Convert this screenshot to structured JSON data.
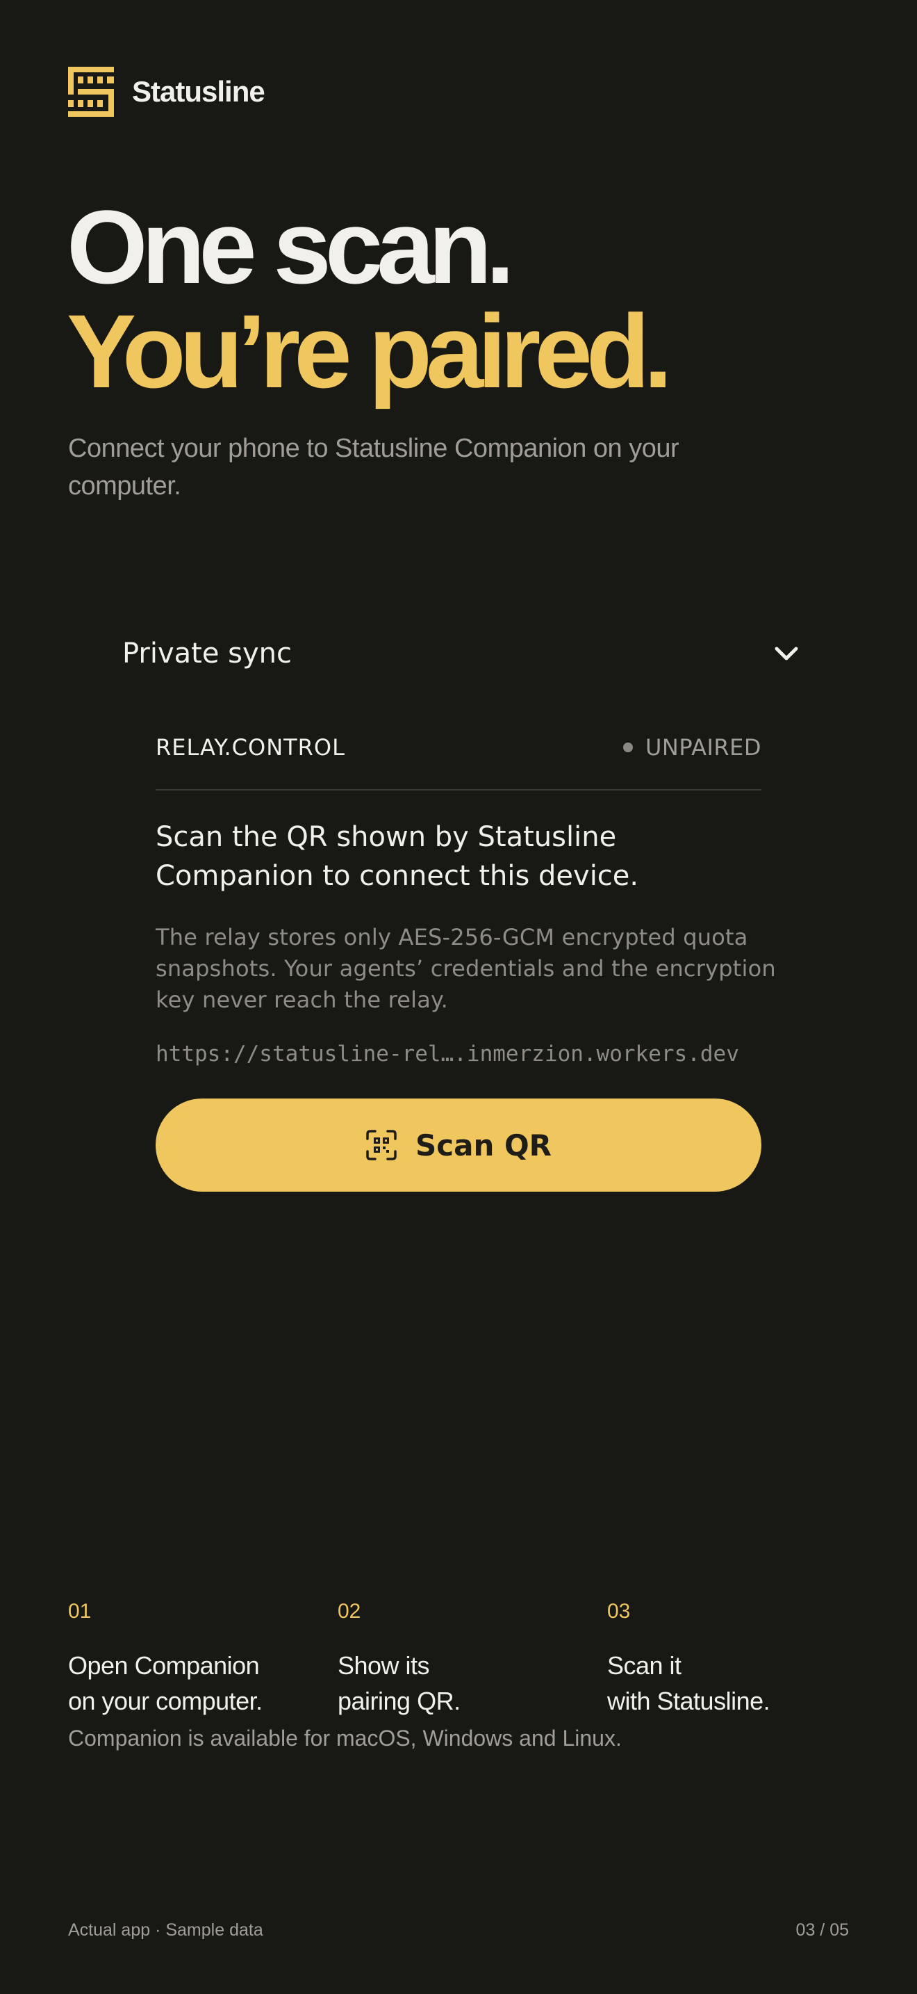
{
  "brand": {
    "name": "Statusline",
    "logo_icon": "statusline-logo-icon",
    "accent": "#efc75e"
  },
  "hero": {
    "line1": "One scan.",
    "line2": "You’re paired.",
    "subtitle": "Connect your phone to Statusline Companion on your computer."
  },
  "sync": {
    "title": "Private sync",
    "chevron_icon": "chevron-down-icon",
    "relay_label": "RELAY.CONTROL",
    "status": "UNPAIRED",
    "instruction": "Scan the QR shown by Statusline Companion to connect this device.",
    "description": "The relay stores only AES-256-GCM encrypted quota snapshots. Your agents’ credentials and the encryption key never reach the relay.",
    "relay_url": "https://statusline-rel….inmerzion.workers.dev",
    "scan_button": {
      "label": "Scan QR",
      "icon": "qr-scan-icon"
    }
  },
  "steps": [
    {
      "num": "01",
      "text": "Open Companion\non your computer."
    },
    {
      "num": "02",
      "text": "Show its\npairing QR."
    },
    {
      "num": "03",
      "text": "Scan it\nwith Statusline."
    }
  ],
  "availability": "Companion is available for macOS, Windows and Linux.",
  "footer": {
    "left": "Actual app · Sample data",
    "right": "03 / 05"
  }
}
